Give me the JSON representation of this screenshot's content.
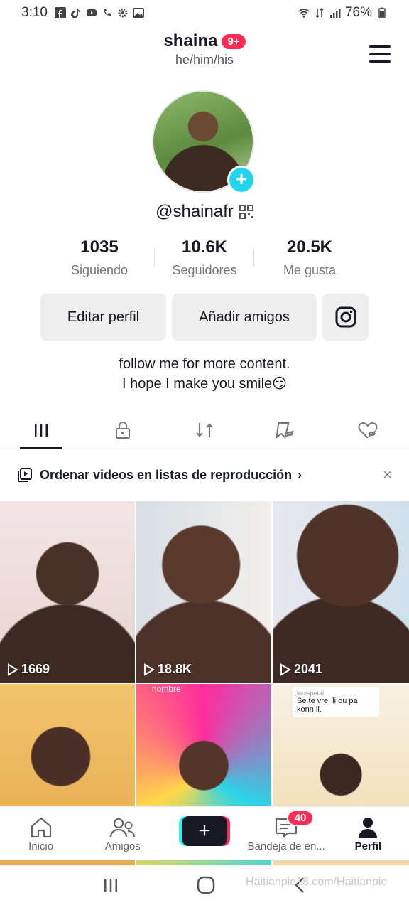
{
  "status_bar": {
    "time": "3:10",
    "battery": "76%"
  },
  "header": {
    "display_name": "shaina",
    "notification_badge": "9+",
    "pronouns": "he/him/his"
  },
  "profile": {
    "handle": "@shainafr",
    "bio_line1": "follow me for more content.",
    "bio_line2": "I hope I make you smile😏"
  },
  "stats": [
    {
      "value": "1035",
      "label": "Siguiendo"
    },
    {
      "value": "10.6K",
      "label": "Seguidores"
    },
    {
      "value": "20.5K",
      "label": "Me gusta"
    }
  ],
  "actions": {
    "edit_label": "Editar perfil",
    "add_friends_label": "Añadir amigos"
  },
  "playlist_banner": {
    "text": "Ordenar videos en listas de reproducción",
    "chevron": "›",
    "close": "×"
  },
  "videos": [
    {
      "views": "1669"
    },
    {
      "views": "18.8K"
    },
    {
      "views": "2041"
    },
    {
      "views": ""
    },
    {
      "views": "",
      "overlay": "nombre"
    },
    {
      "views": "",
      "comment_user": "louispetal",
      "comment_text": "Se te vre, li ou pa konn li."
    }
  ],
  "bottom_nav": {
    "home": "Inicio",
    "friends": "Amigos",
    "inbox": "Bandeja de en...",
    "inbox_badge": "40",
    "profile": "Perfil"
  },
  "watermark": "Haitianpie18.com/Haitianpie",
  "colors": {
    "accent": "#fe2c55",
    "cyan": "#20d5ec",
    "text": "#161823"
  }
}
